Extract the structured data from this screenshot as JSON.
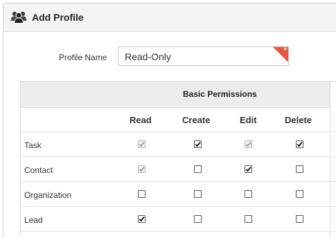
{
  "header": {
    "title": "Add Profile",
    "icon": "users-group-icon"
  },
  "form": {
    "profile_name_label": "Profile Name",
    "profile_name_value": "Read-Only",
    "required_marker": "*"
  },
  "permissions": {
    "group_title": "Basic Permissions",
    "columns": [
      "Read",
      "Create",
      "Edit",
      "Delete"
    ],
    "rows": [
      {
        "label": "Task",
        "checks": [
          {
            "checked": true,
            "disabled": true
          },
          {
            "checked": true,
            "disabled": false
          },
          {
            "checked": true,
            "disabled": true
          },
          {
            "checked": true,
            "disabled": false
          }
        ]
      },
      {
        "label": "Contact",
        "checks": [
          {
            "checked": true,
            "disabled": true
          },
          {
            "checked": false,
            "disabled": false
          },
          {
            "checked": true,
            "disabled": false
          },
          {
            "checked": false,
            "disabled": false
          }
        ]
      },
      {
        "label": "Organization",
        "checks": [
          {
            "checked": false,
            "disabled": false
          },
          {
            "checked": false,
            "disabled": false
          },
          {
            "checked": false,
            "disabled": false
          },
          {
            "checked": false,
            "disabled": false
          }
        ]
      },
      {
        "label": "Lead",
        "checks": [
          {
            "checked": true,
            "disabled": false
          },
          {
            "checked": false,
            "disabled": false
          },
          {
            "checked": false,
            "disabled": false
          },
          {
            "checked": false,
            "disabled": false
          }
        ]
      }
    ]
  }
}
